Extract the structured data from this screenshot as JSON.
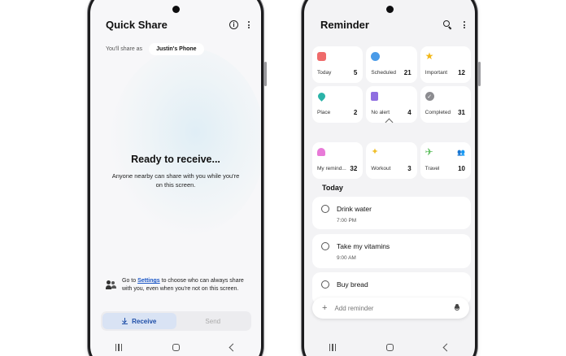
{
  "quick_share": {
    "title": "Quick Share",
    "share_as_label": "You'll share as",
    "device_name": "Justin's Phone",
    "ready_title": "Ready to receive...",
    "ready_description": "Anyone nearby can share with you while you're on this screen.",
    "settings_prefix": "Go to ",
    "settings_link": "Settings",
    "settings_suffix": " to choose who can always share with you, even when you're not on this screen.",
    "receive_label": "Receive",
    "send_label": "Send",
    "active_tab": "Receive"
  },
  "reminder": {
    "title": "Reminder",
    "categories_top": [
      {
        "label": "Today",
        "count": "5",
        "icon": "calendar-icon",
        "color": "#ef6b6b"
      },
      {
        "label": "Scheduled",
        "count": "21",
        "icon": "clock-icon",
        "color": "#4a9be8"
      },
      {
        "label": "Important",
        "count": "12",
        "icon": "star-icon",
        "color": "#f2b716"
      },
      {
        "label": "Place",
        "count": "2",
        "icon": "location-pin-icon",
        "color": "#2bb3a8"
      },
      {
        "label": "No alert",
        "count": "4",
        "icon": "note-icon",
        "color": "#8f6ee0"
      },
      {
        "label": "Completed",
        "count": "31",
        "icon": "check-circle-icon",
        "color": "#8c8c90"
      }
    ],
    "categories_custom": [
      {
        "label": "My remind...",
        "count": "32",
        "icon": "bell-icon",
        "color": "#e87ad8"
      },
      {
        "label": "Workout",
        "count": "3",
        "icon": "runner-icon",
        "color": "#f0c02e"
      },
      {
        "label": "Travel",
        "count": "10",
        "icon": "airplane-icon",
        "color": "#5bbd5b"
      }
    ],
    "section_title": "Today",
    "items": [
      {
        "title": "Drink water",
        "time": "7:00 PM"
      },
      {
        "title": "Take my vitamins",
        "time": "9:00 AM"
      },
      {
        "title": "Buy bread",
        "time": ""
      }
    ],
    "add_placeholder": "Add reminder"
  }
}
